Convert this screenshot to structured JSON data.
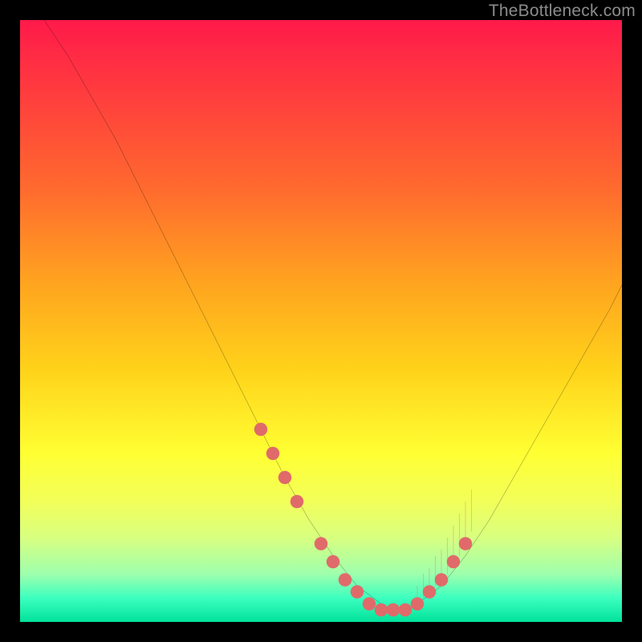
{
  "watermark": "TheBottleneck.com",
  "chart_data": {
    "type": "line",
    "title": "",
    "xlabel": "",
    "ylabel": "",
    "xlim": [
      0,
      100
    ],
    "ylim": [
      0,
      100
    ],
    "series": [
      {
        "name": "bottleneck-curve",
        "x": [
          4,
          8,
          12,
          16,
          20,
          24,
          28,
          32,
          36,
          40,
          44,
          48,
          52,
          56,
          60,
          62,
          64,
          66,
          70,
          74,
          78,
          82,
          86,
          90,
          94,
          98,
          100
        ],
        "y": [
          100,
          94,
          87,
          80,
          72,
          64,
          56,
          48,
          40,
          32,
          24,
          17,
          11,
          6,
          3,
          2,
          2,
          3,
          6,
          11,
          17,
          24,
          31,
          38,
          45,
          52,
          56
        ]
      }
    ],
    "markers": {
      "name": "highlight-dots",
      "color": "#e06a6a",
      "x": [
        40,
        42,
        44,
        46,
        50,
        52,
        54,
        56,
        58,
        60,
        62,
        64,
        66,
        68,
        70,
        72,
        74
      ],
      "y": [
        32,
        28,
        24,
        20,
        13,
        10,
        7,
        5,
        3,
        2,
        2,
        2,
        3,
        5,
        7,
        10,
        13
      ]
    },
    "ticks": {
      "name": "inner-ticks",
      "color": "#e06a6a",
      "x": [
        66,
        67,
        68,
        69,
        70,
        71,
        72,
        73,
        74,
        75
      ],
      "y_from": [
        3,
        4,
        5,
        6,
        7,
        8,
        10,
        11,
        13,
        15
      ],
      "len": [
        3,
        4,
        4,
        5,
        5,
        6,
        6,
        7,
        7,
        7
      ]
    }
  }
}
